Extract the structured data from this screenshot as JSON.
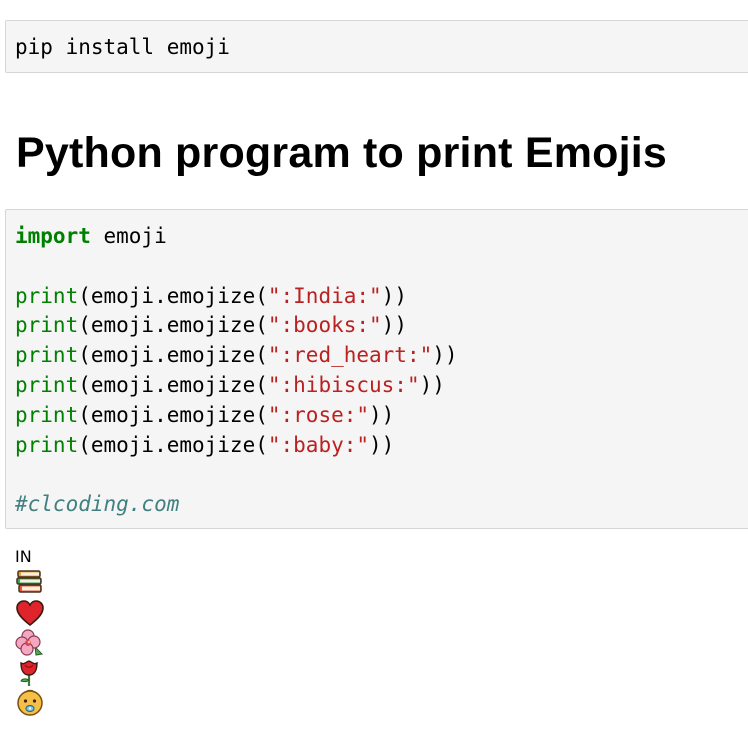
{
  "cells": {
    "install": {
      "code": "pip install emoji"
    },
    "heading": "Python program to print Emojis",
    "program": {
      "import_kw": "import",
      "import_mod": " emoji",
      "print_fn": "print",
      "call_prefix": "(emoji.emojize(",
      "call_suffix": "))",
      "args": [
        "\":India:\"",
        "\":books:\"",
        "\":red_heart:\"",
        "\":hibiscus:\"",
        "\":rose:\"",
        "\":baby:\""
      ],
      "comment": "#clcoding.com"
    }
  },
  "output": {
    "text": "IN",
    "emojis": [
      "books-icon",
      "red-heart-icon",
      "hibiscus-icon",
      "rose-icon",
      "baby-icon"
    ]
  },
  "colors": {
    "keyword": "#008000",
    "string": "#ba2121",
    "comment": "#408080",
    "cell_bg": "#f5f5f5"
  }
}
